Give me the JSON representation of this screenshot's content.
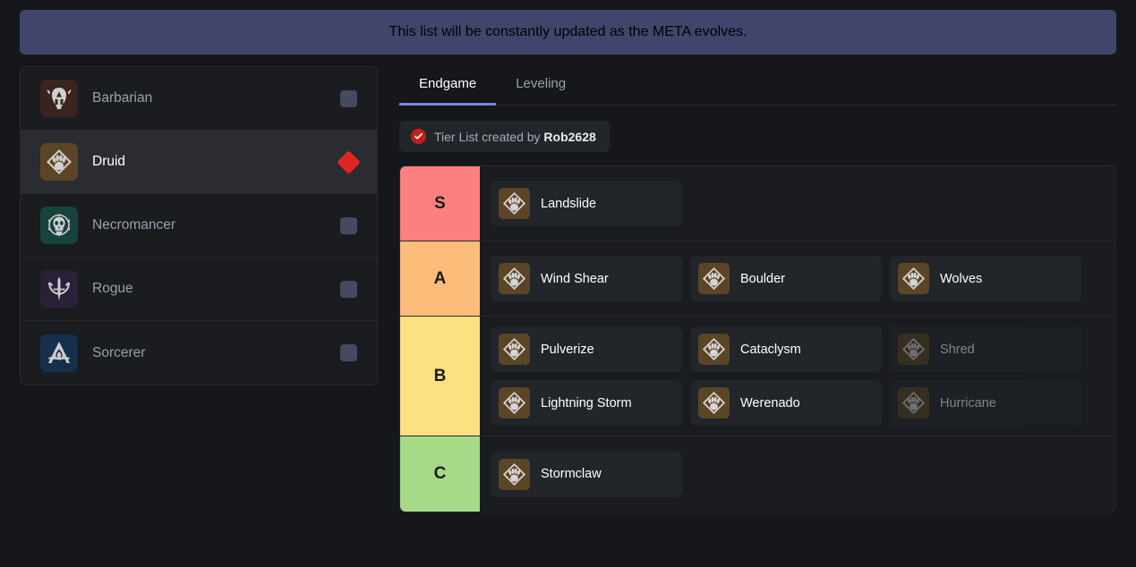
{
  "banner": {
    "text": "This list will be constantly updated as the META evolves."
  },
  "sidebar": {
    "classes": [
      {
        "name": "Barbarian",
        "icon": "barbarian-helmet-icon",
        "bg": "#3a2420",
        "marker": "square",
        "selected": false
      },
      {
        "name": "Druid",
        "icon": "druid-paw-icon",
        "bg": "#5b4526",
        "marker": "diamond",
        "selected": true
      },
      {
        "name": "Necromancer",
        "icon": "necromancer-skull-icon",
        "bg": "#17433e",
        "marker": "square",
        "selected": false
      },
      {
        "name": "Rogue",
        "icon": "rogue-bow-icon",
        "bg": "#2a2038",
        "marker": "square",
        "selected": false
      },
      {
        "name": "Sorcerer",
        "icon": "sorcerer-flame-icon",
        "bg": "#14304d",
        "marker": "square",
        "selected": false
      }
    ],
    "marker_colors": {
      "square": "#454a61",
      "diamond": "#e02424"
    }
  },
  "main": {
    "tabs": [
      {
        "label": "Endgame",
        "active": true
      },
      {
        "label": "Leveling",
        "active": false
      }
    ],
    "credit": {
      "icon": "check-circle-icon",
      "prefix": "Tier List created by",
      "author": "Rob2628"
    },
    "tiers": [
      {
        "label": "S",
        "color": "#fd8080",
        "items": [
          {
            "name": "Landslide",
            "dimmed": false
          }
        ]
      },
      {
        "label": "A",
        "color": "#fdbd7a",
        "items": [
          {
            "name": "Wind Shear",
            "dimmed": false
          },
          {
            "name": "Boulder",
            "dimmed": false
          },
          {
            "name": "Wolves",
            "dimmed": false
          }
        ]
      },
      {
        "label": "B",
        "color": "#fbe182",
        "items": [
          {
            "name": "Pulverize",
            "dimmed": false
          },
          {
            "name": "Cataclysm",
            "dimmed": false
          },
          {
            "name": "Shred",
            "dimmed": true
          },
          {
            "name": "Lightning Storm",
            "dimmed": false
          },
          {
            "name": "Werenado",
            "dimmed": false
          },
          {
            "name": "Hurricane",
            "dimmed": true
          }
        ]
      },
      {
        "label": "C",
        "color": "#a7da88",
        "items": [
          {
            "name": "Stormclaw",
            "dimmed": false
          }
        ]
      }
    ]
  },
  "theme": {
    "page_bg": "#15171a",
    "panel_bg": "#1a1c20",
    "banner_bg": "#41456b",
    "accent": "#7e84d8",
    "skill_bg": "#222529",
    "skill_icon_bg": "#5b4526"
  }
}
